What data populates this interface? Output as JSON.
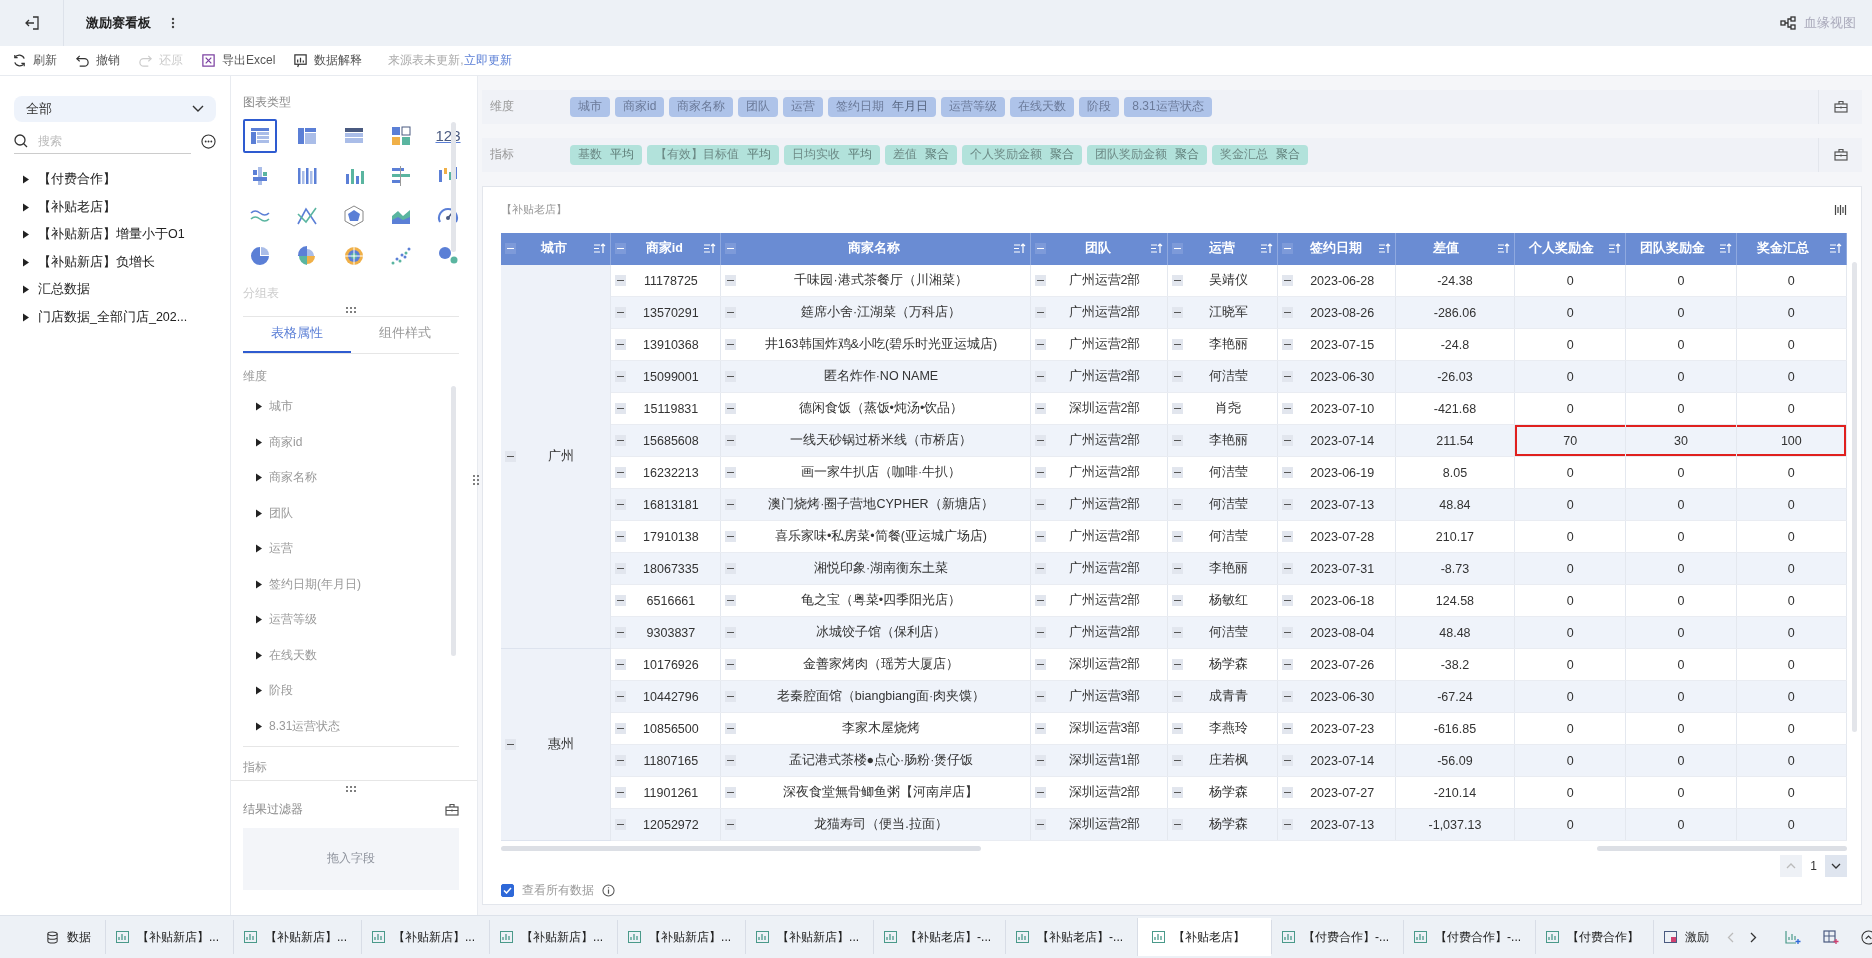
{
  "header": {
    "title": "激励赛看板",
    "lineage_view": "血缘视图"
  },
  "toolbar": {
    "buttons": [
      {
        "kind": "refresh",
        "label": "刷新",
        "disabled": false
      },
      {
        "kind": "undo",
        "label": "撤销",
        "disabled": false
      },
      {
        "kind": "redo",
        "label": "还原",
        "disabled": true
      },
      {
        "kind": "excel",
        "label": "导出Excel",
        "disabled": false
      },
      {
        "kind": "explain",
        "label": "数据解释",
        "disabled": false
      }
    ],
    "notice": "来源表未更新,",
    "notice_link": "立即更新"
  },
  "data_panel": {
    "scope": "全部",
    "search_placeholder": "搜索",
    "items": [
      {
        "label": "【付费合作】"
      },
      {
        "label": "【补贴老店】"
      },
      {
        "label": "【补贴新店】增量小于O1"
      },
      {
        "label": "【补贴新店】负增长"
      },
      {
        "label": "汇总数据"
      },
      {
        "label": "门店数据_全部门店_202..."
      }
    ]
  },
  "chart_types": {
    "title": "图表类型",
    "items": [
      {
        "kind": "table",
        "selected": true
      },
      {
        "kind": "cross-table",
        "selected": false
      },
      {
        "kind": "detail-table",
        "selected": false
      },
      {
        "kind": "card",
        "selected": false
      },
      {
        "kind": "number",
        "label": "123",
        "selected": false
      },
      {
        "kind": "stacked-bar",
        "selected": false
      },
      {
        "kind": "grouped-bar",
        "selected": false
      },
      {
        "kind": "bar",
        "selected": false
      },
      {
        "kind": "horizontal-bar",
        "selected": false
      },
      {
        "kind": "waterfall",
        "selected": false
      },
      {
        "kind": "wave",
        "selected": false
      },
      {
        "kind": "line",
        "selected": false
      },
      {
        "kind": "hexagon",
        "selected": false
      },
      {
        "kind": "area",
        "selected": false
      },
      {
        "kind": "gauge",
        "selected": false
      },
      {
        "kind": "pie",
        "selected": false
      },
      {
        "kind": "rose",
        "selected": false
      },
      {
        "kind": "target",
        "selected": false
      },
      {
        "kind": "scatter",
        "selected": false
      },
      {
        "kind": "bubble",
        "selected": false
      }
    ],
    "group_label": "分组表"
  },
  "property_tabs": [
    {
      "label": "表格属性",
      "selected": true
    },
    {
      "label": "组件样式",
      "selected": false
    }
  ],
  "properties": {
    "dimension_title": "维度",
    "dimension_fields": [
      "城市",
      "商家id",
      "商家名称",
      "团队",
      "运营",
      "签约日期(年月日)",
      "运营等级",
      "在线天数",
      "阶段",
      "8.31运营状态"
    ],
    "measure_title": "指标"
  },
  "result_filter": {
    "title": "结果过滤器",
    "drop_hint": "拖入字段"
  },
  "dimension_bar": {
    "label": "维度",
    "fields": [
      {
        "name": "城市"
      },
      {
        "name": "商家id"
      },
      {
        "name": "商家名称"
      },
      {
        "name": "团队"
      },
      {
        "name": "运营"
      },
      {
        "name": "签约日期",
        "suffix": "年月日"
      },
      {
        "name": "运营等级"
      },
      {
        "name": "在线天数"
      },
      {
        "name": "阶段"
      },
      {
        "name": "8.31运营状态"
      }
    ]
  },
  "measure_bar": {
    "label": "指标",
    "fields": [
      {
        "name": "基数",
        "suffix": "平均"
      },
      {
        "name": "【有效】目标值",
        "suffix": "平均"
      },
      {
        "name": "日均实收",
        "suffix": "平均"
      },
      {
        "name": "差值",
        "suffix": "聚合"
      },
      {
        "name": "个人奖励金额",
        "suffix": "聚合"
      },
      {
        "name": "团队奖励金额",
        "suffix": "聚合"
      },
      {
        "name": "奖金汇总",
        "suffix": "聚合"
      }
    ]
  },
  "table": {
    "title": "【补贴老店】",
    "columns": [
      {
        "label": "城市",
        "collapsible": true
      },
      {
        "label": "商家id",
        "collapsible": true
      },
      {
        "label": "商家名称",
        "collapsible": true
      },
      {
        "label": "团队",
        "collapsible": true
      },
      {
        "label": "运营",
        "collapsible": true
      },
      {
        "label": "签约日期",
        "collapsible": true
      },
      {
        "label": "差值",
        "collapsible": false
      },
      {
        "label": "个人奖励金",
        "collapsible": false
      },
      {
        "label": "团队奖励金",
        "collapsible": false
      },
      {
        "label": "奖金汇总",
        "collapsible": false
      }
    ],
    "groups": [
      {
        "city": "广州",
        "rows": [
          {
            "cells": [
              "11178725",
              "千味园·港式茶餐厅（川湘菜）",
              "广州运营2部",
              "吴靖仪",
              "2023-06-28",
              "-24.38",
              "0",
              "0",
              "0"
            ],
            "highlighted": false
          },
          {
            "cells": [
              "13570291",
              "筵席小舍·江湖菜（万科店）",
              "广州运营2部",
              "江晓军",
              "2023-08-26",
              "-286.06",
              "0",
              "0",
              "0"
            ],
            "highlighted": false
          },
          {
            "cells": [
              "13910368",
              "井163韩国炸鸡&小吃(碧乐时光亚运城店)",
              "广州运营2部",
              "李艳丽",
              "2023-07-15",
              "-24.8",
              "0",
              "0",
              "0"
            ],
            "highlighted": false
          },
          {
            "cells": [
              "15099001",
              "匿名炸作·NO NAME",
              "广州运营2部",
              "何洁莹",
              "2023-06-30",
              "-26.03",
              "0",
              "0",
              "0"
            ],
            "highlighted": false
          },
          {
            "cells": [
              "15119831",
              "德闲食饭（蒸饭•炖汤•饮品）",
              "深圳运营2部",
              "肖尧",
              "2023-07-10",
              "-421.68",
              "0",
              "0",
              "0"
            ],
            "highlighted": false
          },
          {
            "cells": [
              "15685608",
              "一线天砂锅过桥米线（市桥店）",
              "广州运营2部",
              "李艳丽",
              "2023-07-14",
              "211.54",
              "70",
              "30",
              "100"
            ],
            "highlighted": true
          },
          {
            "cells": [
              "16232213",
              "画一家牛扒店（咖啡·牛扒）",
              "广州运营2部",
              "何洁莹",
              "2023-06-19",
              "8.05",
              "0",
              "0",
              "0"
            ],
            "highlighted": false
          },
          {
            "cells": [
              "16813181",
              "澳门烧烤·圈子营地CYPHER（新塘店）",
              "广州运营2部",
              "何洁莹",
              "2023-07-13",
              "48.84",
              "0",
              "0",
              "0"
            ],
            "highlighted": false
          },
          {
            "cells": [
              "17910138",
              "喜乐家味•私房菜•简餐(亚运城广场店)",
              "广州运营2部",
              "何洁莹",
              "2023-07-28",
              "210.17",
              "0",
              "0",
              "0"
            ],
            "highlighted": false
          },
          {
            "cells": [
              "18067335",
              "湘悦印象·湖南衡东土菜",
              "广州运营2部",
              "李艳丽",
              "2023-07-31",
              "-8.73",
              "0",
              "0",
              "0"
            ],
            "highlighted": false
          },
          {
            "cells": [
              "6516661",
              "龟之宝（粤菜•四季阳光店）",
              "广州运营2部",
              "杨敏红",
              "2023-06-18",
              "124.58",
              "0",
              "0",
              "0"
            ],
            "highlighted": false
          },
          {
            "cells": [
              "9303837",
              "冰城饺子馆（保利店）",
              "广州运营2部",
              "何洁莹",
              "2023-08-04",
              "48.48",
              "0",
              "0",
              "0"
            ],
            "highlighted": false
          }
        ]
      },
      {
        "city": "惠州",
        "rows": [
          {
            "cells": [
              "10176926",
              "金善家烤肉（瑶芳大厦店）",
              "深圳运营2部",
              "杨学森",
              "2023-07-26",
              "-38.2",
              "0",
              "0",
              "0"
            ],
            "highlighted": false
          },
          {
            "cells": [
              "10442796",
              "老秦腔面馆（biangbiang面·肉夹馍）",
              "广州运营3部",
              "成青青",
              "2023-06-30",
              "-67.24",
              "0",
              "0",
              "0"
            ],
            "highlighted": false
          },
          {
            "cells": [
              "10856500",
              "李家木屋烧烤",
              "深圳运营3部",
              "李燕玲",
              "2023-07-23",
              "-616.85",
              "0",
              "0",
              "0"
            ],
            "highlighted": false
          },
          {
            "cells": [
              "11807165",
              "孟记港式茶楼●点心·肠粉·煲仔饭",
              "深圳运营1部",
              "庄若枫",
              "2023-07-14",
              "-56.09",
              "0",
              "0",
              "0"
            ],
            "highlighted": false
          },
          {
            "cells": [
              "11901261",
              "深夜食堂無骨鲫鱼粥【河南岸店】",
              "深圳运营2部",
              "杨学森",
              "2023-07-27",
              "-210.14",
              "0",
              "0",
              "0"
            ],
            "highlighted": false
          },
          {
            "cells": [
              "12052972",
              "龙猫寿司（便当.拉面）",
              "深圳运营2部",
              "杨学森",
              "2023-07-13",
              "-1,037.13",
              "0",
              "0",
              "0"
            ],
            "highlighted": false
          }
        ]
      }
    ],
    "show_all": {
      "label": "查看所有数据",
      "checked": true
    },
    "page": "1"
  },
  "sheet_tabs": [
    {
      "kind": "data",
      "label": "数据",
      "selected": false
    },
    {
      "kind": "sheet",
      "label": "【补贴新店】...",
      "selected": false
    },
    {
      "kind": "sheet",
      "label": "【补贴新店】...",
      "selected": false
    },
    {
      "kind": "sheet",
      "label": "【补贴新店】...",
      "selected": false
    },
    {
      "kind": "sheet",
      "label": "【补贴新店】...",
      "selected": false
    },
    {
      "kind": "sheet",
      "label": "【补贴新店】...",
      "selected": false
    },
    {
      "kind": "sheet",
      "label": "【补贴新店】...",
      "selected": false
    },
    {
      "kind": "sheet",
      "label": "【补贴老店】-...",
      "selected": false
    },
    {
      "kind": "sheet",
      "label": "【补贴老店】-...",
      "selected": false
    },
    {
      "kind": "sheet",
      "label": "【补贴老店】",
      "selected": true
    },
    {
      "kind": "sheet",
      "label": "【付费合作】-...",
      "selected": false
    },
    {
      "kind": "sheet",
      "label": "【付费合作】-...",
      "selected": false
    },
    {
      "kind": "sheet",
      "label": "【付费合作】",
      "selected": false
    },
    {
      "kind": "dashboard",
      "label": "激励",
      "selected": false
    }
  ]
}
